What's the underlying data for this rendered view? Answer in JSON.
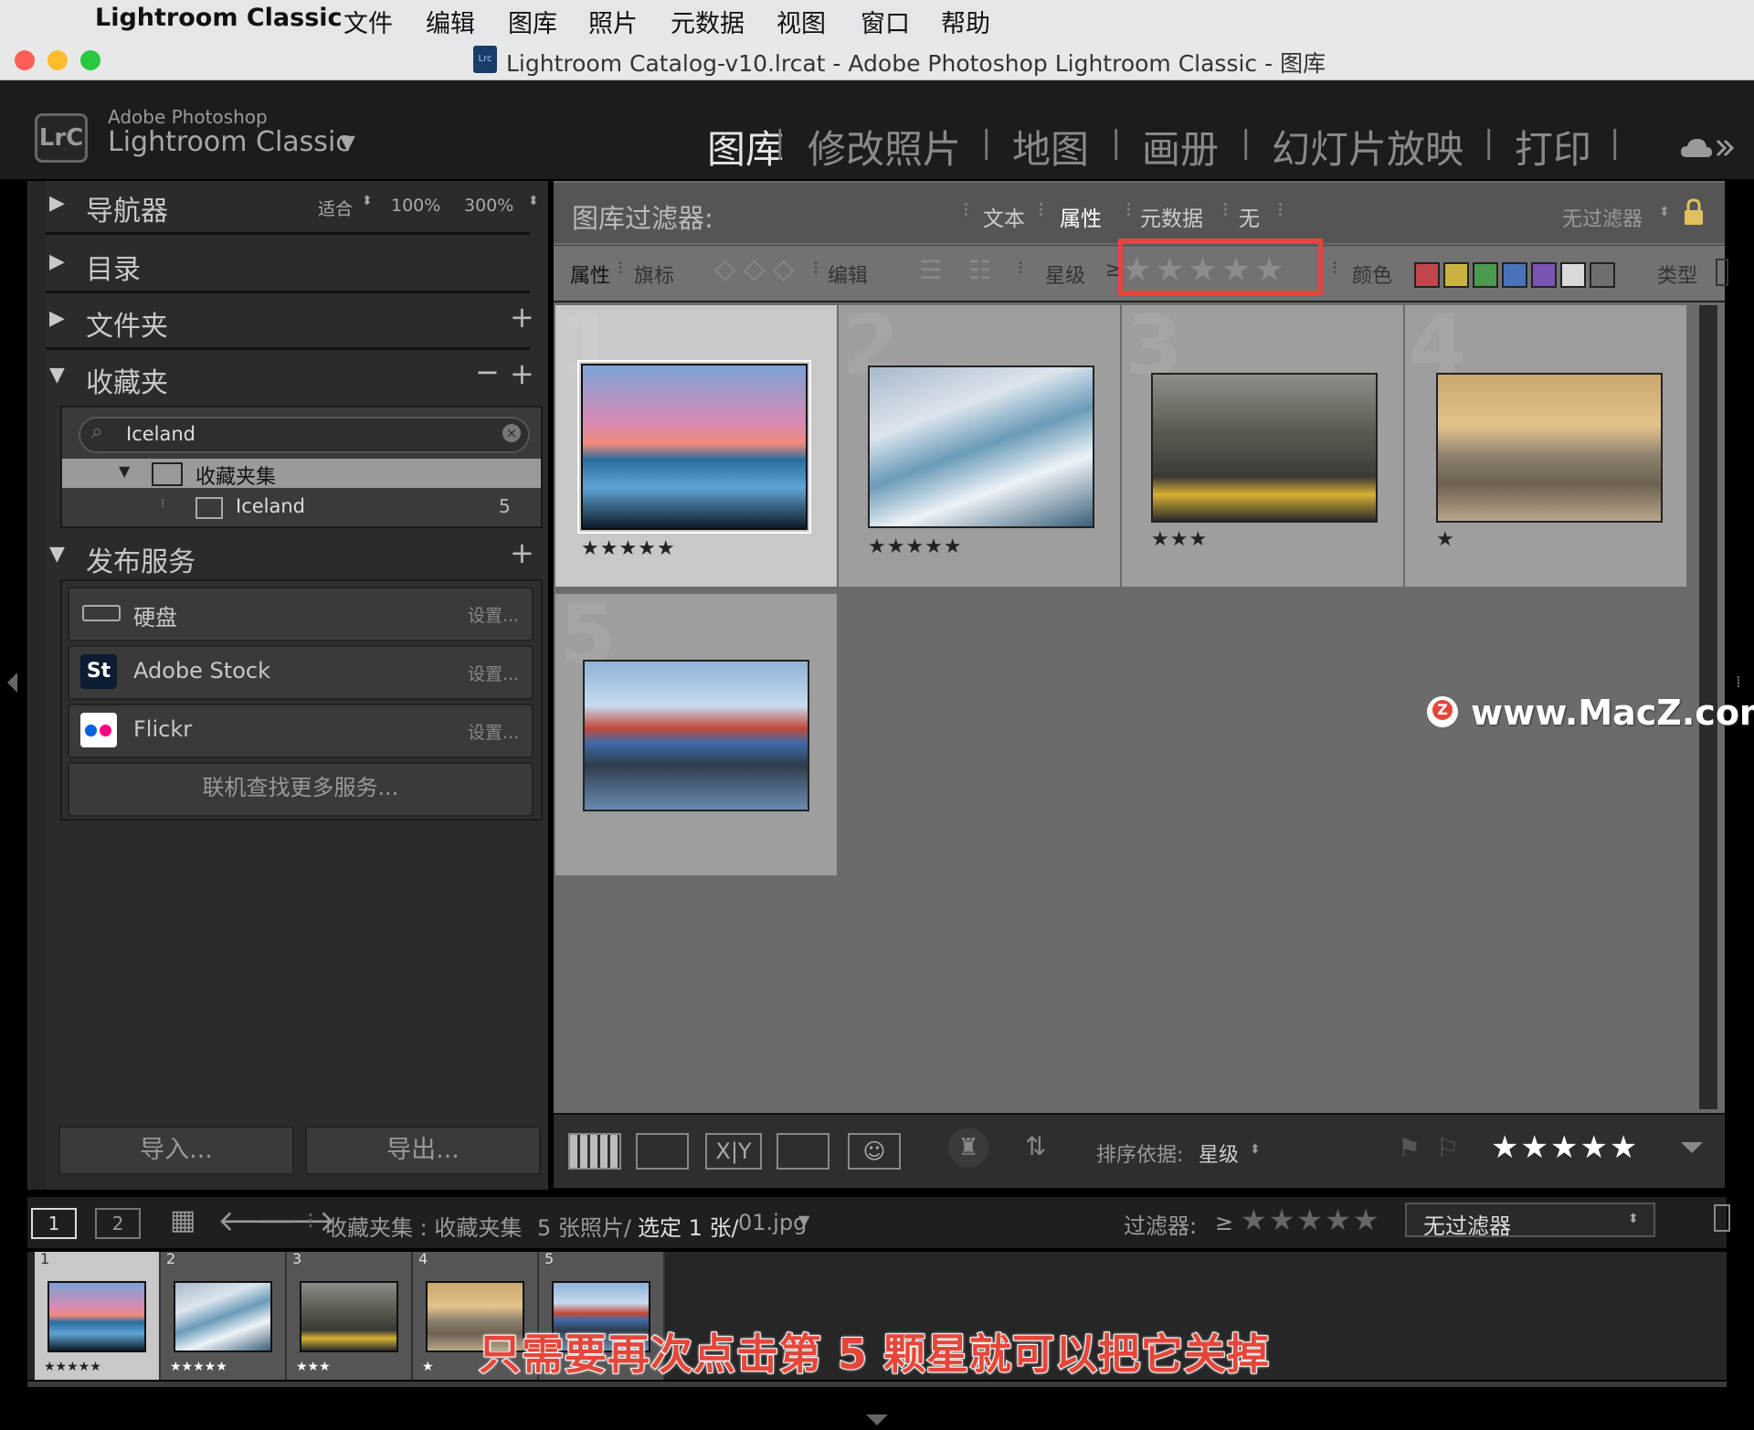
{
  "menubar": {
    "app_name": "Lightroom Classic",
    "items": [
      "文件",
      "编辑",
      "图库",
      "照片",
      "元数据",
      "视图",
      "窗口",
      "帮助"
    ]
  },
  "window": {
    "title": "Lightroom Catalog-v10.lrcat - Adobe Photoshop Lightroom Classic - 图库",
    "icon_text": "Lrc"
  },
  "identity": {
    "logo": "LrC",
    "line1": "Adobe Photoshop",
    "line2": "Lightroom Classic",
    "dropdown": "▼",
    "modules": [
      "图库",
      "修改照片",
      "地图",
      "画册",
      "幻灯片放映",
      "打印"
    ]
  },
  "left_panel": {
    "navigator": {
      "label": "导航器",
      "zoom_fit": "适合",
      "zoom_100": "100%",
      "zoom_300": "300%"
    },
    "catalog": {
      "label": "目录"
    },
    "folders": {
      "label": "文件夹"
    },
    "collections": {
      "label": "收藏夹",
      "search_value": "Iceland",
      "set_name": "收藏夹集",
      "collection_name": "Iceland",
      "collection_count": "5"
    },
    "publish": {
      "label": "发布服务",
      "services": [
        {
          "name": "硬盘",
          "setup": "设置..."
        },
        {
          "name": "Adobe Stock",
          "setup": "设置...",
          "icon_text": "St"
        },
        {
          "name": "Flickr",
          "setup": "设置..."
        }
      ],
      "find_more": "联机查找更多服务..."
    },
    "import_label": "导入...",
    "export_label": "导出..."
  },
  "filter_bar": {
    "title": "图库过滤器:",
    "tabs": [
      "文本",
      "属性",
      "元数据",
      "无"
    ],
    "preset": "无过滤器",
    "attr_label": "属性",
    "flag_label": "旗标",
    "edit_label": "编辑",
    "rating_label": "星级",
    "rating_op": "≥",
    "rating_stars": "★★★★★",
    "color_label": "颜色",
    "type_label": "类型"
  },
  "grid": {
    "cells": [
      {
        "num": "1",
        "stars": "★★★★★"
      },
      {
        "num": "2",
        "stars": "★★★★★"
      },
      {
        "num": "3",
        "stars": "★★★"
      },
      {
        "num": "4",
        "stars": "★"
      },
      {
        "num": "5",
        "stars": ""
      }
    ]
  },
  "watermark": "www.MacZ.com",
  "toolbar": {
    "sort_label": "排序依据:",
    "sort_value": "星级",
    "rating_stars": "★★★★★"
  },
  "filmstrip_header": {
    "screen1": "1",
    "screen2": "2",
    "source": "收藏夹集 : 收藏夹集",
    "count": "5 张照片/",
    "selected": "选定 1 张/",
    "filename": "01.jpg",
    "filter_label": "过滤器:",
    "filter_op": "≥",
    "filter_stars": "★★★★★",
    "filter_value": "无过滤器"
  },
  "filmstrip": [
    {
      "num": "1",
      "stars": "★★★★★"
    },
    {
      "num": "2",
      "stars": "★★★★★"
    },
    {
      "num": "3",
      "stars": "★★★"
    },
    {
      "num": "4",
      "stars": "★"
    },
    {
      "num": "5",
      "stars": ""
    }
  ],
  "caption": "只需要再次点击第 5 颗星就可以把它关掉",
  "colors": {
    "highlight_box": "#e4473a",
    "caption_fill": "#e4473a",
    "swatches": [
      "#c0474c",
      "#c9b340",
      "#4b9a4f",
      "#4a72b8",
      "#7a55b4",
      "#d9d9d9",
      "#6e6e6e"
    ]
  }
}
